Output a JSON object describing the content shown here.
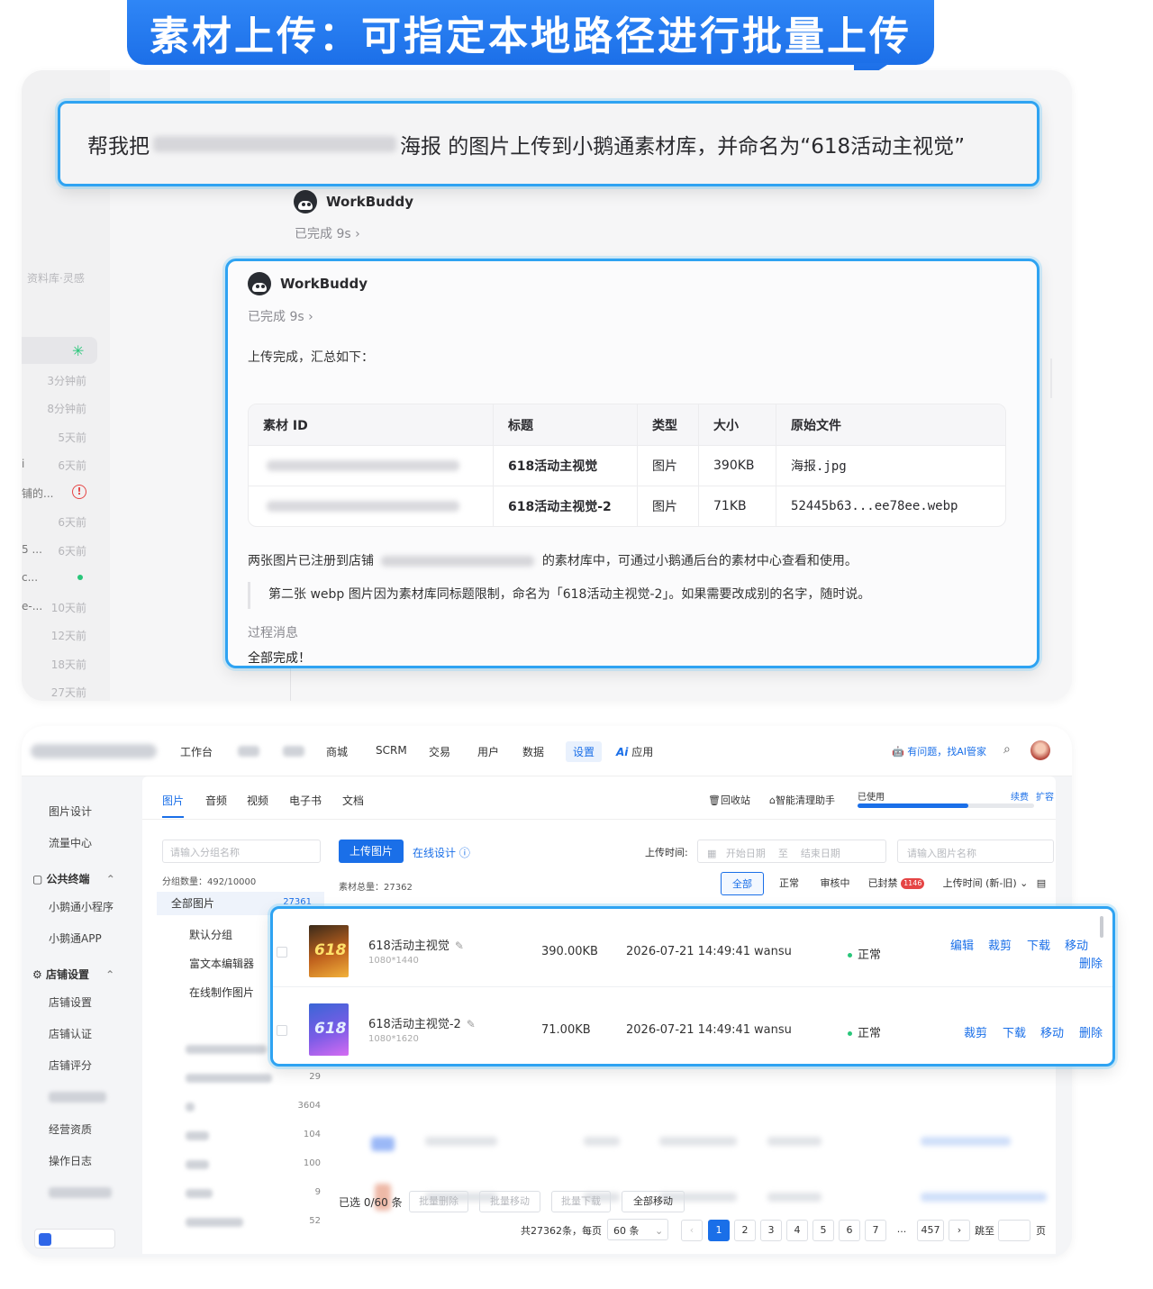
{
  "banner": {
    "title": "素材上传：可指定本地路径进行批量上传"
  },
  "prompt": {
    "prefix": "帮我把",
    "suffix": "海报 的图片上传到小鹅通素材库，并命名为“618活动主视觉”"
  },
  "chat_bg": {
    "assistant_name": "WorkBuddy",
    "status": "已完成 9s",
    "sidebar_label": "资料库·灵感",
    "times": [
      "3分钟前",
      "8分钟前",
      "5天前",
      "6天前",
      "6天前",
      "6天前",
      "10天前",
      "12天前",
      "18天前",
      "27天前"
    ],
    "fragments": [
      "i",
      "铺的...",
      "5 ...",
      "c...",
      "e-..."
    ]
  },
  "result": {
    "assistant_name": "WorkBuddy",
    "status": "已完成 9s",
    "intro": "上传完成，汇总如下：",
    "table": {
      "headers": [
        "素材 ID",
        "标题",
        "类型",
        "大小",
        "原始文件"
      ],
      "rows": [
        {
          "title": "618活动主视觉",
          "type": "图片",
          "size": "390KB",
          "file": "海报.jpg"
        },
        {
          "title": "618活动主视觉-2",
          "type": "图片",
          "size": "71KB",
          "file": "52445b63...ee78ee.webp"
        }
      ]
    },
    "note1_a": "两张图片已注册到店铺",
    "note1_b": "的素材库中，可通过小鹅通后台的素材中心查看和使用。",
    "note2": "第二张 webp 图片因为素材库同标题限制，命名为「618活动主视觉-2」。如果需要改成别的名字，随时说。",
    "process_label": "过程消息",
    "all_done": "全部完成！"
  },
  "admin": {
    "nav": [
      "工作台",
      "商城",
      "SCRM",
      "交易",
      "用户",
      "数据",
      "设置",
      "应用"
    ],
    "ai_helper": "有问题，找AI管家",
    "left": {
      "items_top": [
        "图片设计",
        "流量中心"
      ],
      "section1": "公共终端",
      "section1_items": [
        "小鹅通小程序",
        "小鹅通APP"
      ],
      "section2": "店铺设置",
      "section2_items": [
        "店铺设置",
        "店铺认证",
        "店铺评分",
        "经营资质",
        "操作日志"
      ]
    },
    "tabs": [
      "图片",
      "音频",
      "视频",
      "电子书",
      "文档"
    ],
    "tools": {
      "recycle": "回收站",
      "clean": "智能清理助手",
      "used": "已使用",
      "renew": "续费",
      "expand": "扩容",
      "usage_fraction": 0.63
    },
    "groups": {
      "search_placeholder": "请输入分组名称",
      "count": "分组数量：492/10000",
      "all": "全部图片",
      "all_count": "27361",
      "subs": [
        "默认分组",
        "富文本编辑器",
        "在线制作图片"
      ],
      "blurred_counts": [
        "29",
        "3604",
        "104",
        "100",
        "9",
        "52"
      ]
    },
    "list": {
      "upload_btn": "上传图片",
      "online_design": "在线设计",
      "upload_time_label": "上传时间:",
      "start_date": "开始日期",
      "to": "至",
      "end_date": "结束日期",
      "name_placeholder": "请输入图片名称",
      "total": "素材总量：27362",
      "filters": [
        "全部",
        "正常",
        "审核中",
        "已封禁"
      ],
      "banned_badge": "1146",
      "sort": "上传时间 (新-旧)"
    },
    "bottom": {
      "selected": "已选 0/60 条",
      "batch_delete": "批量删除",
      "batch_move": "批量移动",
      "batch_download": "批量下载",
      "move_all": "全部移动",
      "pager_total": "共27362条，每页",
      "per_page": "60 条",
      "pages": [
        "1",
        "2",
        "3",
        "4",
        "5",
        "6",
        "7",
        "...",
        "457"
      ],
      "jump": "跳至",
      "page_unit": "页"
    }
  },
  "hl_rows": [
    {
      "title": "618活动主视觉",
      "dim": "1080*1440",
      "size": "390.00KB",
      "date": "2026-07-21 14:49:41",
      "user": "wansu",
      "status": "正常",
      "actions": [
        "编辑",
        "裁剪",
        "下载",
        "移动",
        "删除"
      ]
    },
    {
      "title": "618活动主视觉-2",
      "dim": "1080*1620",
      "size": "71.00KB",
      "date": "2026-07-21 14:49:41",
      "user": "wansu",
      "status": "正常",
      "actions": [
        "裁剪",
        "下载",
        "移动",
        "删除"
      ]
    }
  ],
  "thumb_text": "618"
}
